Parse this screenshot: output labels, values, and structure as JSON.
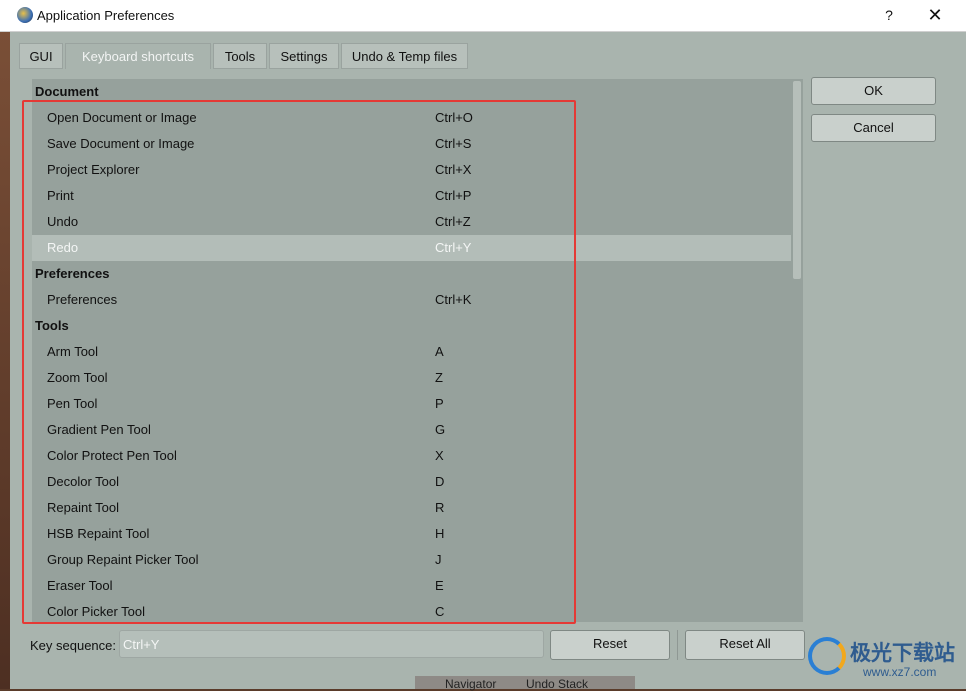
{
  "window": {
    "title": "Application Preferences",
    "help": "?",
    "close": "✕"
  },
  "tabs": [
    {
      "label": "GUI"
    },
    {
      "label": "Keyboard shortcuts"
    },
    {
      "label": "Tools"
    },
    {
      "label": "Settings"
    },
    {
      "label": "Undo & Temp files"
    }
  ],
  "shortcuts": [
    {
      "type": "header",
      "name": "Document",
      "key": ""
    },
    {
      "type": "item",
      "name": "Open Document or Image",
      "key": "Ctrl+O"
    },
    {
      "type": "item",
      "name": "Save Document or Image",
      "key": "Ctrl+S"
    },
    {
      "type": "item",
      "name": "Project Explorer",
      "key": "Ctrl+X"
    },
    {
      "type": "item",
      "name": "Print",
      "key": "Ctrl+P"
    },
    {
      "type": "item",
      "name": "Undo",
      "key": "Ctrl+Z"
    },
    {
      "type": "item",
      "name": "Redo",
      "key": "Ctrl+Y",
      "selected": true
    },
    {
      "type": "header",
      "name": "Preferences",
      "key": ""
    },
    {
      "type": "item",
      "name": "Preferences",
      "key": "Ctrl+K"
    },
    {
      "type": "header",
      "name": "Tools",
      "key": ""
    },
    {
      "type": "item",
      "name": "Arm Tool",
      "key": "A"
    },
    {
      "type": "item",
      "name": "Zoom Tool",
      "key": "Z"
    },
    {
      "type": "item",
      "name": "Pen Tool",
      "key": "P"
    },
    {
      "type": "item",
      "name": "Gradient Pen Tool",
      "key": "G"
    },
    {
      "type": "item",
      "name": "Color Protect Pen Tool",
      "key": "X"
    },
    {
      "type": "item",
      "name": "Decolor Tool",
      "key": "D"
    },
    {
      "type": "item",
      "name": "Repaint Tool",
      "key": "R"
    },
    {
      "type": "item",
      "name": "HSB Repaint Tool",
      "key": "H"
    },
    {
      "type": "item",
      "name": "Group Repaint Picker Tool",
      "key": "J"
    },
    {
      "type": "item",
      "name": "Eraser Tool",
      "key": "E"
    },
    {
      "type": "item",
      "name": "Color Picker Tool",
      "key": "C"
    }
  ],
  "buttons": {
    "ok": "OK",
    "cancel": "Cancel",
    "reset": "Reset",
    "reset_all": "Reset All"
  },
  "key_sequence": {
    "label": "Key sequence:",
    "value": "Ctrl+Y"
  },
  "background_tabs": {
    "navigator": "Navigator",
    "undo_stack": "Undo Stack"
  },
  "watermark": {
    "brand": "极光下载站",
    "url": "www.xz7.com"
  },
  "colors": {
    "highlight_box": "#e53935",
    "panel": "#a9b4ae",
    "list_bg": "#96a19c",
    "selected_row": "#b3bdb8"
  },
  "icons": {
    "app": "app-logo-icon",
    "close": "close-icon",
    "help": "help-icon"
  }
}
